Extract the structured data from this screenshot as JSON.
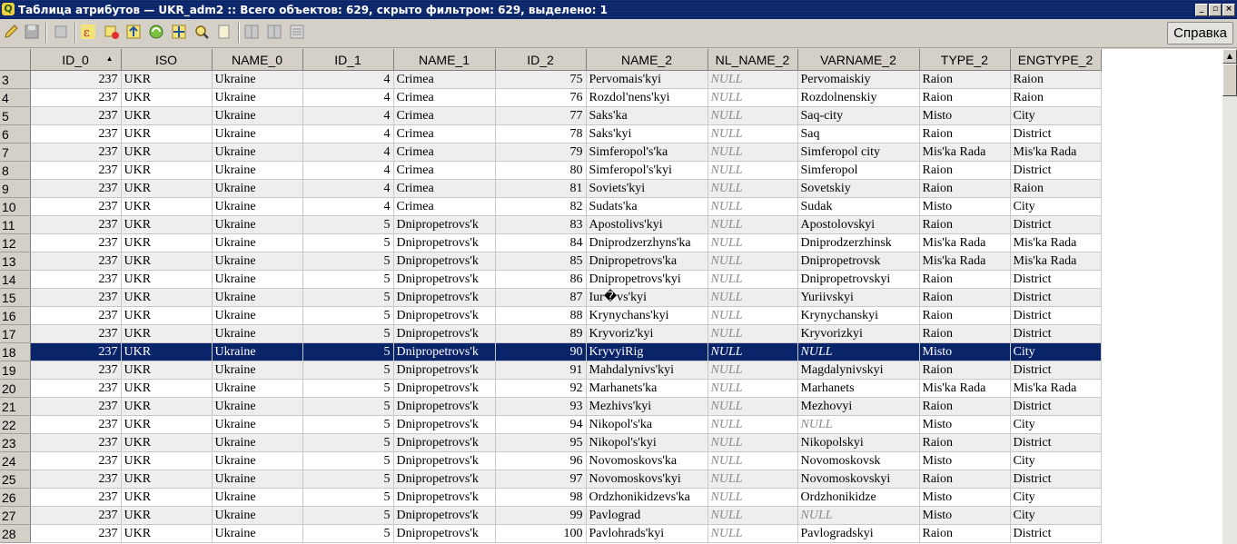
{
  "window": {
    "title": "Таблица атрибутов — UKR_adm2 :: Всего объектов: 629, скрыто фильтром: 629, выделено: 1",
    "app_icon": "Q"
  },
  "toolbar": {
    "buttons": [
      "pencil-icon",
      "save-icon",
      "delete-icon",
      "expression-icon",
      "deselect-icon",
      "move-top-icon",
      "invert-icon",
      "pan-icon",
      "zoom-icon",
      "copy-icon",
      "new-column-icon",
      "delete-column-icon",
      "field-calc-icon"
    ],
    "help_label": "Справка"
  },
  "table": {
    "columns": [
      "ID_0",
      "ISO",
      "NAME_0",
      "ID_1",
      "NAME_1",
      "ID_2",
      "NAME_2",
      "NL_NAME_2",
      "VARNAME_2",
      "TYPE_2",
      "ENGTYPE_2"
    ],
    "sorted_column": "ID_0",
    "selected_row": "18",
    "rows": [
      {
        "n": "3",
        "c": [
          "237",
          "UKR",
          "Ukraine",
          "4",
          "Crimea",
          "75",
          "Pervomais'kyi",
          "NULL",
          "Pervomaiskiy",
          "Raion",
          "Raion"
        ]
      },
      {
        "n": "4",
        "c": [
          "237",
          "UKR",
          "Ukraine",
          "4",
          "Crimea",
          "76",
          "Rozdol'nens'kyi",
          "NULL",
          "Rozdolnenskiy",
          "Raion",
          "Raion"
        ]
      },
      {
        "n": "5",
        "c": [
          "237",
          "UKR",
          "Ukraine",
          "4",
          "Crimea",
          "77",
          "Saks'ka",
          "NULL",
          "Saq-city",
          "Misto",
          "City"
        ]
      },
      {
        "n": "6",
        "c": [
          "237",
          "UKR",
          "Ukraine",
          "4",
          "Crimea",
          "78",
          "Saks'kyi",
          "NULL",
          "Saq",
          "Raion",
          "District"
        ]
      },
      {
        "n": "7",
        "c": [
          "237",
          "UKR",
          "Ukraine",
          "4",
          "Crimea",
          "79",
          "Simferopol's'ka",
          "NULL",
          "Simferopol city",
          "Mis'ka Rada",
          "Mis'ka Rada"
        ]
      },
      {
        "n": "8",
        "c": [
          "237",
          "UKR",
          "Ukraine",
          "4",
          "Crimea",
          "80",
          "Simferopol's'kyi",
          "NULL",
          "Simferopol",
          "Raion",
          "District"
        ]
      },
      {
        "n": "9",
        "c": [
          "237",
          "UKR",
          "Ukraine",
          "4",
          "Crimea",
          "81",
          "Soviets'kyi",
          "NULL",
          "Sovetskiy",
          "Raion",
          "Raion"
        ]
      },
      {
        "n": "10",
        "c": [
          "237",
          "UKR",
          "Ukraine",
          "4",
          "Crimea",
          "82",
          "Sudats'ka",
          "NULL",
          "Sudak",
          "Misto",
          "City"
        ]
      },
      {
        "n": "11",
        "c": [
          "237",
          "UKR",
          "Ukraine",
          "5",
          "Dnipropetrovs'k",
          "83",
          "Apostolivs'kyi",
          "NULL",
          "Apostolovskyi",
          "Raion",
          "District"
        ]
      },
      {
        "n": "12",
        "c": [
          "237",
          "UKR",
          "Ukraine",
          "5",
          "Dnipropetrovs'k",
          "84",
          "Dniprodzerzhyns'ka",
          "NULL",
          "Dniprodzerzhinsk",
          "Mis'ka Rada",
          "Mis'ka Rada"
        ]
      },
      {
        "n": "13",
        "c": [
          "237",
          "UKR",
          "Ukraine",
          "5",
          "Dnipropetrovs'k",
          "85",
          "Dnipropetrovs'ka",
          "NULL",
          "Dnipropetrovsk",
          "Mis'ka Rada",
          "Mis'ka Rada"
        ]
      },
      {
        "n": "14",
        "c": [
          "237",
          "UKR",
          "Ukraine",
          "5",
          "Dnipropetrovs'k",
          "86",
          "Dnipropetrovs'kyi",
          "NULL",
          "Dnipropetrovskyi",
          "Raion",
          "District"
        ]
      },
      {
        "n": "15",
        "c": [
          "237",
          "UKR",
          "Ukraine",
          "5",
          "Dnipropetrovs'k",
          "87",
          "Iur�vs'kyi",
          "NULL",
          "Yuriivskyi",
          "Raion",
          "District"
        ]
      },
      {
        "n": "16",
        "c": [
          "237",
          "UKR",
          "Ukraine",
          "5",
          "Dnipropetrovs'k",
          "88",
          "Krynychans'kyi",
          "NULL",
          "Krynychanskyi",
          "Raion",
          "District"
        ]
      },
      {
        "n": "17",
        "c": [
          "237",
          "UKR",
          "Ukraine",
          "5",
          "Dnipropetrovs'k",
          "89",
          "Kryvoriz'kyi",
          "NULL",
          "Kryvorizkyi",
          "Raion",
          "District"
        ]
      },
      {
        "n": "18",
        "c": [
          "237",
          "UKR",
          "Ukraine",
          "5",
          "Dnipropetrovs'k",
          "90",
          "KryvyiRig",
          "NULL",
          "NULL",
          "Misto",
          "City"
        ]
      },
      {
        "n": "19",
        "c": [
          "237",
          "UKR",
          "Ukraine",
          "5",
          "Dnipropetrovs'k",
          "91",
          "Mahdalynivs'kyi",
          "NULL",
          "Magdalynivskyi",
          "Raion",
          "District"
        ]
      },
      {
        "n": "20",
        "c": [
          "237",
          "UKR",
          "Ukraine",
          "5",
          "Dnipropetrovs'k",
          "92",
          "Marhanets'ka",
          "NULL",
          "Marhanets",
          "Mis'ka Rada",
          "Mis'ka Rada"
        ]
      },
      {
        "n": "21",
        "c": [
          "237",
          "UKR",
          "Ukraine",
          "5",
          "Dnipropetrovs'k",
          "93",
          "Mezhivs'kyi",
          "NULL",
          "Mezhovyi",
          "Raion",
          "District"
        ]
      },
      {
        "n": "22",
        "c": [
          "237",
          "UKR",
          "Ukraine",
          "5",
          "Dnipropetrovs'k",
          "94",
          "Nikopol's'ka",
          "NULL",
          "NULL",
          "Misto",
          "City"
        ]
      },
      {
        "n": "23",
        "c": [
          "237",
          "UKR",
          "Ukraine",
          "5",
          "Dnipropetrovs'k",
          "95",
          "Nikopol's'kyi",
          "NULL",
          "Nikopolskyi",
          "Raion",
          "District"
        ]
      },
      {
        "n": "24",
        "c": [
          "237",
          "UKR",
          "Ukraine",
          "5",
          "Dnipropetrovs'k",
          "96",
          "Novomoskovs'ka",
          "NULL",
          "Novomoskovsk",
          "Misto",
          "City"
        ]
      },
      {
        "n": "25",
        "c": [
          "237",
          "UKR",
          "Ukraine",
          "5",
          "Dnipropetrovs'k",
          "97",
          "Novomoskovs'kyi",
          "NULL",
          "Novomoskovskyi",
          "Raion",
          "District"
        ]
      },
      {
        "n": "26",
        "c": [
          "237",
          "UKR",
          "Ukraine",
          "5",
          "Dnipropetrovs'k",
          "98",
          "Ordzhonikidzevs'ka",
          "NULL",
          "Ordzhonikidze",
          "Misto",
          "City"
        ]
      },
      {
        "n": "27",
        "c": [
          "237",
          "UKR",
          "Ukraine",
          "5",
          "Dnipropetrovs'k",
          "99",
          "Pavlograd",
          "NULL",
          "NULL",
          "Misto",
          "City"
        ]
      },
      {
        "n": "28",
        "c": [
          "237",
          "UKR",
          "Ukraine",
          "5",
          "Dnipropetrovs'k",
          "100",
          "Pavlohrads'kyi",
          "NULL",
          "Pavlogradskyi",
          "Raion",
          "District"
        ]
      }
    ]
  }
}
